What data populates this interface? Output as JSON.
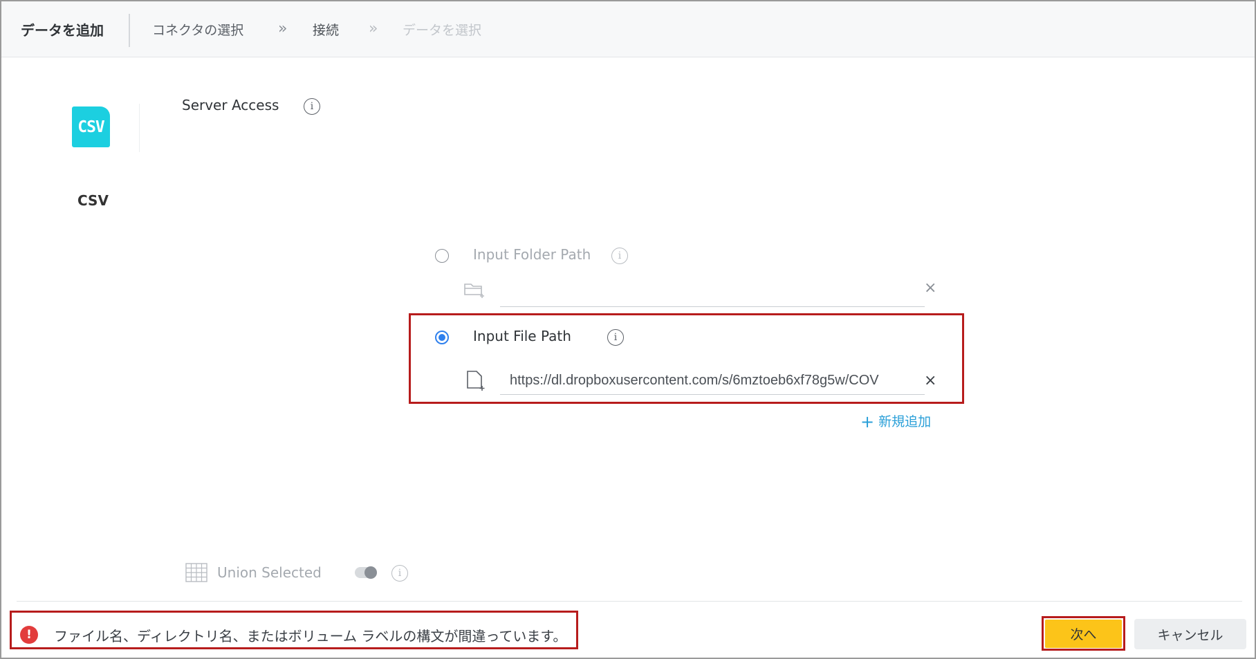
{
  "header": {
    "title": "データを追加",
    "breadcrumbs": [
      {
        "label": "コネクタの選択",
        "state": "done"
      },
      {
        "label": "接続",
        "state": "current"
      },
      {
        "label": "データを選択",
        "state": "disabled"
      }
    ],
    "separator_glyph": "»"
  },
  "connector": {
    "logo_text": "CSV",
    "name": "CSV",
    "logo_color": "#1ccfe0"
  },
  "server_access": {
    "title": "Server Access",
    "info_icon": "i"
  },
  "options": {
    "folder_path": {
      "label": "Input Folder Path",
      "selected": false,
      "value": "",
      "icon": "folder-add-icon"
    },
    "file_path": {
      "label": "Input File Path",
      "selected": true,
      "value": "https://dl.dropboxusercontent.com/s/6mztoeb6xf78g5w/COV",
      "icon": "file-add-icon"
    },
    "clear_glyph": "×"
  },
  "add_new": {
    "plus": "+",
    "label": "新規追加"
  },
  "union": {
    "label": "Union Selected",
    "enabled": false
  },
  "footer": {
    "error_glyph": "!",
    "error_message": "ファイル名、ディレクトリ名、またはボリューム ラベルの構文が間違っています。",
    "next_label": "次へ",
    "cancel_label": "キャンセル"
  },
  "colors": {
    "accent": "#2f80ed",
    "link": "#2a9fd8",
    "primary_button": "#fcc419",
    "error": "#e23c3c",
    "highlight": "#b71c1c"
  }
}
